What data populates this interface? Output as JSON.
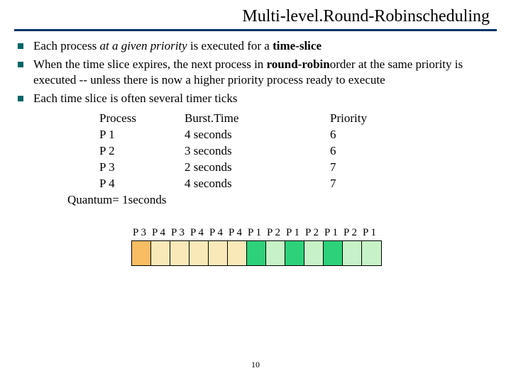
{
  "title": "Multi-level.Round-Robinscheduling",
  "bullets": [
    {
      "pre": "Each process ",
      "ital": "at a given priority",
      "mid": " is executed for a ",
      "bold": "time-slice",
      "post": ""
    },
    {
      "pre": "When the time slice expires, the next process in ",
      "bold": "round-robin",
      "post": "order at the same priority is executed -- unless there is now a higher priority process ready to execute"
    },
    {
      "pre": "Each time slice is often several timer ticks"
    }
  ],
  "table": {
    "headers": {
      "process": "Process",
      "burst": "Burst.Time",
      "priority": "Priority"
    },
    "rows": [
      {
        "process": "P 1",
        "burst": "4 seconds",
        "priority": "6"
      },
      {
        "process": "P 2",
        "burst": "3 seconds",
        "priority": "6"
      },
      {
        "process": "P 3",
        "burst": "2 seconds",
        "priority": "7"
      },
      {
        "process": "P 4",
        "burst": "4 seconds",
        "priority": "7"
      }
    ]
  },
  "quantum": "Quantum= 1seconds",
  "chart_data": {
    "type": "bar",
    "title": "",
    "categories": [
      "P 3",
      "P 4",
      "P 3",
      "P 4",
      "P 4",
      "P 4",
      "P 1",
      "P 2",
      "P 1",
      "P 2",
      "P 1",
      "P 2",
      "P 1"
    ],
    "colors": [
      "#f8bc63",
      "#fae9b8",
      "#fae9b8",
      "#fae9b8",
      "#fae9b8",
      "#fae9b8",
      "#2dd17a",
      "#c7f2c7",
      "#2dd17a",
      "#c7f2c7",
      "#2dd17a",
      "#c7f2c7",
      "#c7f2c7"
    ],
    "values": [
      1,
      1,
      1,
      1,
      1,
      1,
      1,
      1,
      1,
      1,
      1,
      1,
      1
    ],
    "xlabel": "",
    "ylabel": "",
    "ylim": [
      0,
      1
    ]
  },
  "page": "10"
}
